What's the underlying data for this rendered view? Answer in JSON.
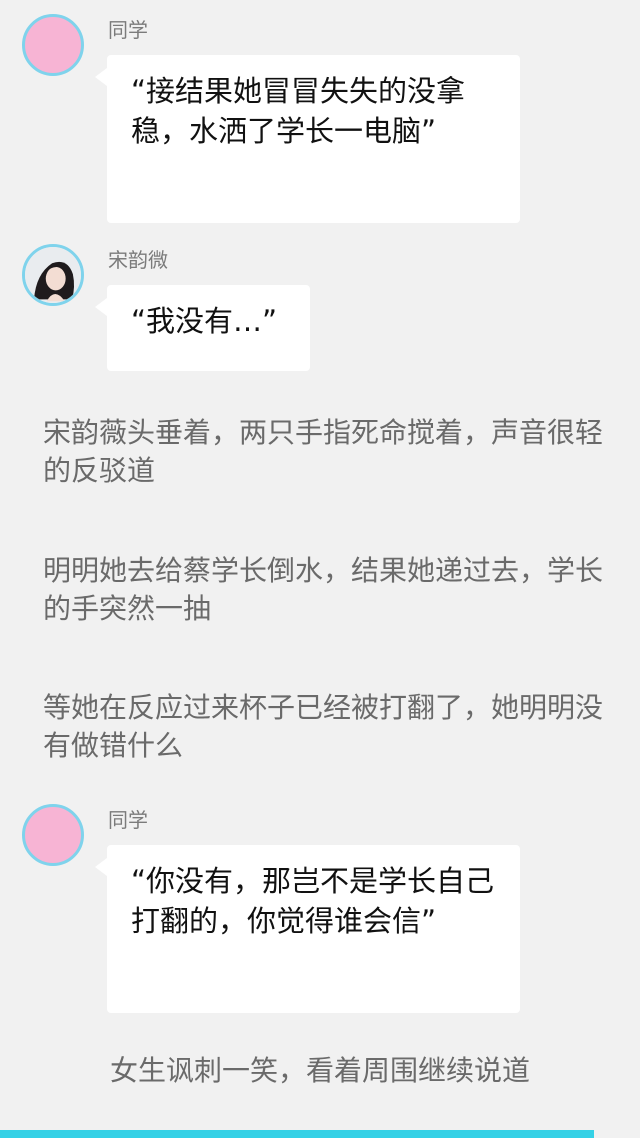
{
  "colors": {
    "background": "#f1f1f1",
    "bubble": "#ffffff",
    "avatar_border": "#7fd3ec",
    "pink_avatar": "#f7b4d4",
    "accent_bar": "#35d1e6"
  },
  "messages": [
    {
      "sender": "同学",
      "avatar_icon": "pink-avatar-icon",
      "text": "“接结果她冒冒失失的没拿稳，水洒了学长一电脑”"
    },
    {
      "sender": "宋韵微",
      "avatar_icon": "photo-avatar-icon",
      "text": "“我没有…”"
    },
    {
      "sender": "同学",
      "avatar_icon": "pink-avatar-icon",
      "text": "“你没有，那岂不是学长自己打翻的，你觉得谁会信”"
    }
  ],
  "narrations": [
    "宋韵薇头垂着，两只手指死命搅着，声音很轻的反驳道",
    "明明她去给蔡学长倒水，结果她递过去，学长的手突然一抽",
    "等她在反应过来杯子已经被打翻了，她明明没有做错什么",
    "女生讽刺一笑，看着周围继续说道"
  ]
}
